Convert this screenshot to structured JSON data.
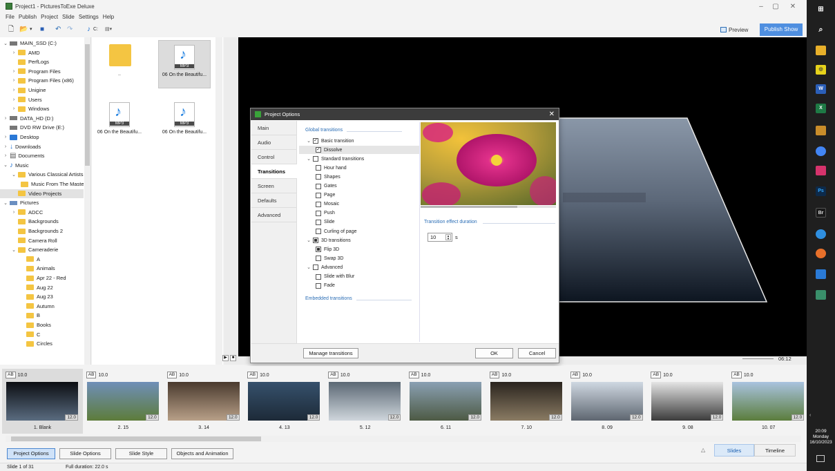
{
  "window": {
    "title": "Project1 - PicturesToExe Deluxe",
    "minimize": "–",
    "maximize": "▢",
    "close": "✕"
  },
  "menu": [
    "File",
    "Publish",
    "Project",
    "Slide",
    "Settings",
    "Help"
  ],
  "toolbar": {
    "preview": "Preview",
    "publish": "Publish Show",
    "music_icon": "music-note-icon",
    "drive": "C:"
  },
  "tree": [
    {
      "label": "MAIN_SSD (C:)",
      "level": 0,
      "exp": "v",
      "icon": "drive"
    },
    {
      "label": "AMD",
      "level": 1,
      "exp": ">",
      "icon": "folder"
    },
    {
      "label": "PerfLogs",
      "level": 1,
      "exp": "",
      "icon": "folder"
    },
    {
      "label": "Program Files",
      "level": 1,
      "exp": ">",
      "icon": "folder"
    },
    {
      "label": "Program Files (x86)",
      "level": 1,
      "exp": ">",
      "icon": "folder"
    },
    {
      "label": "Unigine",
      "level": 1,
      "exp": ">",
      "icon": "folder"
    },
    {
      "label": "Users",
      "level": 1,
      "exp": ">",
      "icon": "folder"
    },
    {
      "label": "Windows",
      "level": 1,
      "exp": ">",
      "icon": "folder"
    },
    {
      "label": "DATA_HD (D:)",
      "level": 0,
      "exp": ">",
      "icon": "drive"
    },
    {
      "label": "DVD RW Drive (E:)",
      "level": 0,
      "exp": "",
      "icon": "drive"
    },
    {
      "label": "Desktop",
      "level": 0,
      "exp": ">",
      "icon": "desktop"
    },
    {
      "label": "Downloads",
      "level": 0,
      "exp": ">",
      "icon": "download"
    },
    {
      "label": "Documents",
      "level": 0,
      "exp": ">",
      "icon": "doc"
    },
    {
      "label": "Music",
      "level": 0,
      "exp": "v",
      "icon": "music"
    },
    {
      "label": "Various Classical Artists",
      "level": 1,
      "exp": "v",
      "icon": "folder"
    },
    {
      "label": "Music From The Master",
      "level": 2,
      "exp": "",
      "icon": "folder"
    },
    {
      "label": "Video Projects",
      "level": 1,
      "exp": "",
      "icon": "folder",
      "selected": true
    },
    {
      "label": "Pictures",
      "level": 0,
      "exp": "v",
      "icon": "pictures"
    },
    {
      "label": "ADCC",
      "level": 1,
      "exp": ">",
      "icon": "folder"
    },
    {
      "label": "Backgrounds",
      "level": 1,
      "exp": "",
      "icon": "folder"
    },
    {
      "label": "Backgrounds 2",
      "level": 1,
      "exp": "",
      "icon": "folder"
    },
    {
      "label": "Camera Roll",
      "level": 1,
      "exp": "",
      "icon": "folder"
    },
    {
      "label": "Cameraderie",
      "level": 1,
      "exp": "v",
      "icon": "folder"
    },
    {
      "label": "A",
      "level": 2,
      "exp": "",
      "icon": "folder"
    },
    {
      "label": "Animals",
      "level": 2,
      "exp": "",
      "icon": "folder"
    },
    {
      "label": "Apr 22 - Red",
      "level": 2,
      "exp": "",
      "icon": "folder"
    },
    {
      "label": "Aug 22",
      "level": 2,
      "exp": "",
      "icon": "folder"
    },
    {
      "label": "Aug 23",
      "level": 2,
      "exp": "",
      "icon": "folder"
    },
    {
      "label": "Autumn",
      "level": 2,
      "exp": "",
      "icon": "folder"
    },
    {
      "label": "B",
      "level": 2,
      "exp": "",
      "icon": "folder"
    },
    {
      "label": "Books",
      "level": 2,
      "exp": "",
      "icon": "folder"
    },
    {
      "label": "C",
      "level": 2,
      "exp": "",
      "icon": "folder"
    },
    {
      "label": "Circles",
      "level": 2,
      "exp": "",
      "icon": "folder"
    }
  ],
  "files": [
    {
      "label": "..",
      "type": "folder"
    },
    {
      "label": "06 On the Beautifu...",
      "type": "mp3",
      "selected": true
    },
    {
      "label": "06 On the Beautifu...",
      "type": "mp3"
    },
    {
      "label": "06 On the Beautifu...",
      "type": "mp3"
    }
  ],
  "mp3_tag": "MP3",
  "player": {
    "time": "06:12",
    "play": "▶",
    "stop": "■"
  },
  "dialog": {
    "title": "Project Options",
    "tabs": [
      "Main",
      "Audio",
      "Control",
      "Transitions",
      "Screen",
      "Defaults",
      "Advanced"
    ],
    "global_header": "Global transitions",
    "embedded_header": "Embedded transitions",
    "items": [
      {
        "label": "Basic transition",
        "indent": 0,
        "exp": "v",
        "state": "checked"
      },
      {
        "label": "Dissolve",
        "indent": 1,
        "exp": "",
        "state": "checked",
        "highlight": true
      },
      {
        "label": "Standard transitions",
        "indent": 0,
        "exp": "v",
        "state": "unchecked"
      },
      {
        "label": "Hour hand",
        "indent": 1,
        "exp": "",
        "state": "unchecked"
      },
      {
        "label": "Shapes",
        "indent": 1,
        "exp": "",
        "state": "unchecked"
      },
      {
        "label": "Gates",
        "indent": 1,
        "exp": "",
        "state": "unchecked"
      },
      {
        "label": "Page",
        "indent": 1,
        "exp": "",
        "state": "unchecked"
      },
      {
        "label": "Mosaic",
        "indent": 1,
        "exp": "",
        "state": "unchecked"
      },
      {
        "label": "Push",
        "indent": 1,
        "exp": "",
        "state": "unchecked"
      },
      {
        "label": "Slide",
        "indent": 1,
        "exp": "",
        "state": "unchecked"
      },
      {
        "label": "Curling of page",
        "indent": 1,
        "exp": "",
        "state": "unchecked"
      },
      {
        "label": "3D transitions",
        "indent": 0,
        "exp": "v",
        "state": "indeterminate"
      },
      {
        "label": "Flip 3D",
        "indent": 1,
        "exp": "",
        "state": "indeterminate"
      },
      {
        "label": "Swap 3D",
        "indent": 1,
        "exp": "",
        "state": "unchecked"
      },
      {
        "label": "Advanced",
        "indent": 0,
        "exp": "v",
        "state": "unchecked"
      },
      {
        "label": "Slide with Blur",
        "indent": 1,
        "exp": "",
        "state": "unchecked"
      },
      {
        "label": "Fade",
        "indent": 1,
        "exp": "",
        "state": "unchecked"
      }
    ],
    "duration_label": "Transition effect duration",
    "duration_value": "10",
    "duration_unit": "s",
    "manage": "Manage transitions",
    "ok": "OK",
    "cancel": "Cancel"
  },
  "slides": [
    {
      "ab": "AB",
      "dur": "10.0",
      "label": "1. Blank",
      "tdur": "12.0",
      "colors": [
        "#0b0d12",
        "#5a6c80"
      ]
    },
    {
      "ab": "AB",
      "dur": "10.0",
      "label": "2. 15",
      "tdur": "12.0",
      "colors": [
        "#6f8fb8",
        "#5d7c3a"
      ]
    },
    {
      "ab": "AB",
      "dur": "10.0",
      "label": "3. 14",
      "tdur": "12.0",
      "colors": [
        "#4a3a2e",
        "#b8a088"
      ]
    },
    {
      "ab": "AB",
      "dur": "10.0",
      "label": "4. 13",
      "tdur": "12.0",
      "colors": [
        "#36516c",
        "#1d2a38"
      ]
    },
    {
      "ab": "AB",
      "dur": "10.0",
      "label": "5. 12",
      "tdur": "12.0",
      "colors": [
        "#5b6874",
        "#cfd6dc"
      ]
    },
    {
      "ab": "AB",
      "dur": "10.0",
      "label": "6. 11",
      "tdur": "12.0",
      "colors": [
        "#8aa0b3",
        "#4d5a44"
      ]
    },
    {
      "ab": "AB",
      "dur": "10.0",
      "label": "7. 10",
      "tdur": "12.0",
      "colors": [
        "#2a241e",
        "#8a7b63"
      ]
    },
    {
      "ab": "AB",
      "dur": "10.0",
      "label": "8. 09",
      "tdur": "12.0",
      "colors": [
        "#cfd8e2",
        "#5e6670"
      ]
    },
    {
      "ab": "AB",
      "dur": "10.0",
      "label": "9. 08",
      "tdur": "12.0",
      "colors": [
        "#e4e4e4",
        "#3b3b3b"
      ]
    },
    {
      "ab": "AB",
      "dur": "10.0",
      "label": "10. 07",
      "tdur": "12.0",
      "colors": [
        "#a9c3df",
        "#5b7d3c"
      ]
    }
  ],
  "bottom": {
    "project_options": "Project Options",
    "slide_options": "Slide Options",
    "slide_style": "Slide Style",
    "objects": "Objects and Animation",
    "slides": "Slides",
    "timeline": "Timeline",
    "warn": "△"
  },
  "status": {
    "slide": "Slide 1 of 31",
    "duration": "Full duration: 22.0 s"
  },
  "clock": {
    "time": "20:09",
    "day": "Monday",
    "date": "16/10/2023"
  }
}
